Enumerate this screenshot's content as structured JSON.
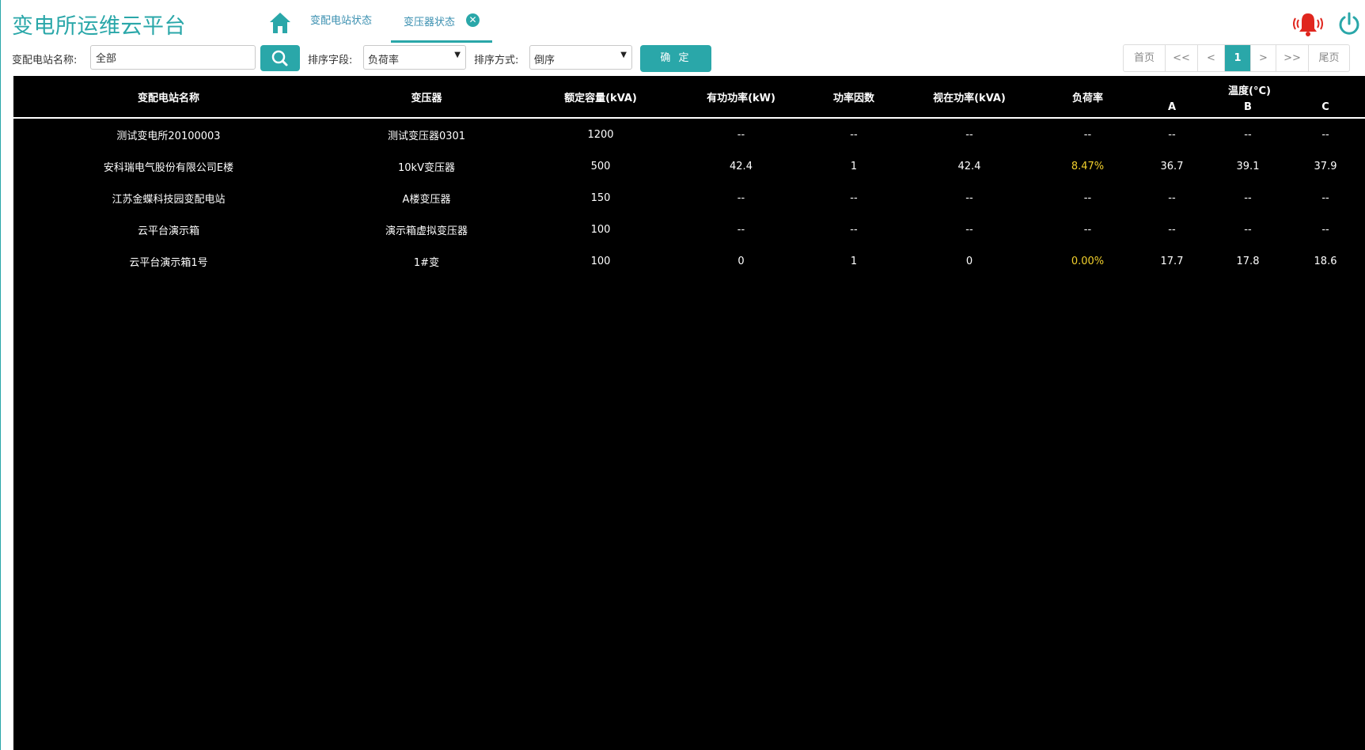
{
  "app": {
    "title": "变电所运维云平台"
  },
  "colors": {
    "accent": "#2aa7a9",
    "alarm": "#e0261e",
    "load_highlight": "#f2d02c",
    "grid_bg": "#000000"
  },
  "icons": {
    "home": "home-icon",
    "close": "close-icon",
    "alarm": "bell-icon",
    "power": "power-icon",
    "search": "search-icon"
  },
  "tabs": [
    {
      "label": "变配电站状态",
      "active": false
    },
    {
      "label": "变压器状态",
      "active": true,
      "closable": true
    }
  ],
  "filters": {
    "station_label": "变配电站名称:",
    "station_value": "全部",
    "sort_field_label": "排序字段:",
    "sort_field_value": "负荷率",
    "sort_order_label": "排序方式:",
    "sort_order_value": "倒序",
    "confirm_label": "确 定"
  },
  "pagination": {
    "first": "首页",
    "prev_many": "<<",
    "prev": "<",
    "current": "1",
    "next": ">",
    "next_many": ">>",
    "last": "尾页"
  },
  "table": {
    "headers": {
      "station": "变配电站名称",
      "transformer": "变压器",
      "capacity": "额定容量(kVA)",
      "active_power": "有功功率(kW)",
      "power_factor": "功率因数",
      "apparent_power": "视在功率(kVA)",
      "load_rate": "负荷率",
      "temperature": "温度(°C)",
      "temp_a": "A",
      "temp_b": "B",
      "temp_c": "C"
    },
    "rows": [
      {
        "station": "测试变电所20100003",
        "transformer": "测试变压器0301",
        "capacity": "1200",
        "active_power": "--",
        "power_factor": "--",
        "apparent_power": "--",
        "load_rate": "--",
        "temp_a": "--",
        "temp_b": "--",
        "temp_c": "--"
      },
      {
        "station": "安科瑞电气股份有限公司E楼",
        "transformer": "10kV变压器",
        "capacity": "500",
        "active_power": "42.4",
        "power_factor": "1",
        "apparent_power": "42.4",
        "load_rate": "8.47%",
        "temp_a": "36.7",
        "temp_b": "39.1",
        "temp_c": "37.9"
      },
      {
        "station": "江苏金蝶科技园变配电站",
        "transformer": "A楼变压器",
        "capacity": "150",
        "active_power": "--",
        "power_factor": "--",
        "apparent_power": "--",
        "load_rate": "--",
        "temp_a": "--",
        "temp_b": "--",
        "temp_c": "--"
      },
      {
        "station": "云平台演示箱",
        "transformer": "演示箱虚拟变压器",
        "capacity": "100",
        "active_power": "--",
        "power_factor": "--",
        "apparent_power": "--",
        "load_rate": "--",
        "temp_a": "--",
        "temp_b": "--",
        "temp_c": "--"
      },
      {
        "station": "云平台演示箱1号",
        "transformer": "1#变",
        "capacity": "100",
        "active_power": "0",
        "power_factor": "1",
        "apparent_power": "0",
        "load_rate": "0.00%",
        "temp_a": "17.7",
        "temp_b": "17.8",
        "temp_c": "18.6"
      }
    ]
  }
}
